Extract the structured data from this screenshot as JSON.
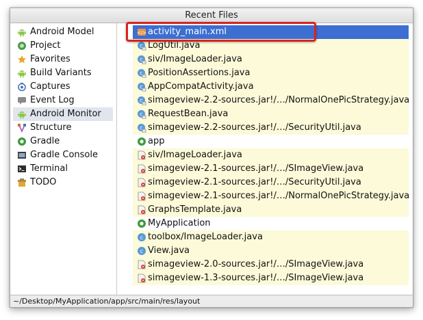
{
  "window": {
    "title": "Recent Files"
  },
  "sidebar": {
    "items": [
      {
        "label": "Android Model",
        "icon": "android-icon",
        "selected": false
      },
      {
        "label": "Project",
        "icon": "project-icon",
        "selected": false
      },
      {
        "label": "Favorites",
        "icon": "star-icon",
        "selected": false
      },
      {
        "label": "Build Variants",
        "icon": "android-icon",
        "selected": false
      },
      {
        "label": "Captures",
        "icon": "camera-icon",
        "selected": false
      },
      {
        "label": "Event Log",
        "icon": "event-log-icon",
        "selected": false
      },
      {
        "label": "Android Monitor",
        "icon": "android-icon",
        "selected": true
      },
      {
        "label": "Structure",
        "icon": "structure-icon",
        "selected": false
      },
      {
        "label": "Gradle",
        "icon": "gradle-icon",
        "selected": false
      },
      {
        "label": "Gradle Console",
        "icon": "console-icon",
        "selected": false
      },
      {
        "label": "Terminal",
        "icon": "terminal-icon",
        "selected": false
      },
      {
        "label": "TODO",
        "icon": "todo-icon",
        "selected": false
      }
    ]
  },
  "files": [
    {
      "name": "activity_main.xml",
      "icon": "xml-file-icon",
      "selected": true
    },
    {
      "name": "LogUtil.java",
      "icon": "java-class-icon"
    },
    {
      "name": "siv/ImageLoader.java",
      "icon": "java-class-icon"
    },
    {
      "name": "PositionAssertions.java",
      "icon": "java-class-icon"
    },
    {
      "name": "AppCompatActivity.java",
      "icon": "java-class-icon"
    },
    {
      "name": "simageview-2.2-sources.jar!/…/NormalOnePicStrategy.java",
      "icon": "java-class-icon"
    },
    {
      "name": "RequestBean.java",
      "icon": "java-class-icon"
    },
    {
      "name": "simageview-2.2-sources.jar!/…/SecurityUtil.java",
      "icon": "java-class-icon"
    },
    {
      "name": "app",
      "icon": "module-icon",
      "plain": true
    },
    {
      "name": "siv/ImageLoader.java",
      "icon": "java-locked-icon"
    },
    {
      "name": "simageview-2.1-sources.jar!/…/SImageView.java",
      "icon": "java-locked-icon"
    },
    {
      "name": "simageview-2.1-sources.jar!/…/SecurityUtil.java",
      "icon": "java-locked-icon"
    },
    {
      "name": "simageview-2.1-sources.jar!/…/NormalOnePicStrategy.java",
      "icon": "java-locked-icon"
    },
    {
      "name": "GraphsTemplate.java",
      "icon": "java-locked-icon"
    },
    {
      "name": "MyApplication",
      "icon": "module-icon",
      "plain": true
    },
    {
      "name": "toolbox/ImageLoader.java",
      "icon": "java-class-plain-icon"
    },
    {
      "name": "View.java",
      "icon": "java-class-plain-icon"
    },
    {
      "name": "simageview-2.0-sources.jar!/…/SImageView.java",
      "icon": "java-locked-icon"
    },
    {
      "name": "simageview-1.3-sources.jar!/…/SImageView.java",
      "icon": "java-locked-icon"
    }
  ],
  "status": {
    "path": "~/Desktop/MyApplication/app/src/main/res/layout"
  },
  "colors": {
    "selection": "#3d6ed1",
    "row_highlight": "#fcfad8",
    "annotation_box": "#d9231e"
  }
}
